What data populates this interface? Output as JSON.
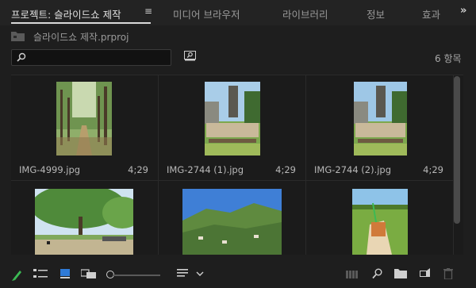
{
  "tabs": [
    {
      "label": "프로젝트: 슬라이드쇼 제작",
      "active": true
    },
    {
      "label": "미디어 브라우저",
      "active": false
    },
    {
      "label": "라이브러리",
      "active": false
    },
    {
      "label": "정보",
      "active": false
    },
    {
      "label": "효과",
      "active": false
    }
  ],
  "tab_menu_glyph": "≡",
  "overflow_glyph": "»",
  "project": {
    "filename": "슬라이드쇼 제작.prproj"
  },
  "search": {
    "value": "",
    "placeholder": ""
  },
  "item_count": "6 항목",
  "items": [
    {
      "name": "IMG-4999.jpg",
      "duration": "4;29"
    },
    {
      "name": "IMG-2744 (1).jpg",
      "duration": "4;29"
    },
    {
      "name": "IMG-2744 (2).jpg",
      "duration": "4;29"
    },
    {
      "name": "",
      "duration": ""
    },
    {
      "name": "",
      "duration": ""
    },
    {
      "name": "",
      "duration": ""
    }
  ],
  "colors": {
    "accent_blue": "#2f7bd8",
    "pencil_green": "#3cba54",
    "panel_bg": "#1e1e1e"
  },
  "bottom_icons": [
    "pencil-icon",
    "list-view-icon",
    "icon-view-icon",
    "freeform-view-icon",
    "zoom-slider",
    "sort-icon",
    "chevron-down-icon",
    "automate-sequence-icon",
    "find-icon",
    "new-bin-icon",
    "new-item-icon",
    "trash-icon"
  ]
}
